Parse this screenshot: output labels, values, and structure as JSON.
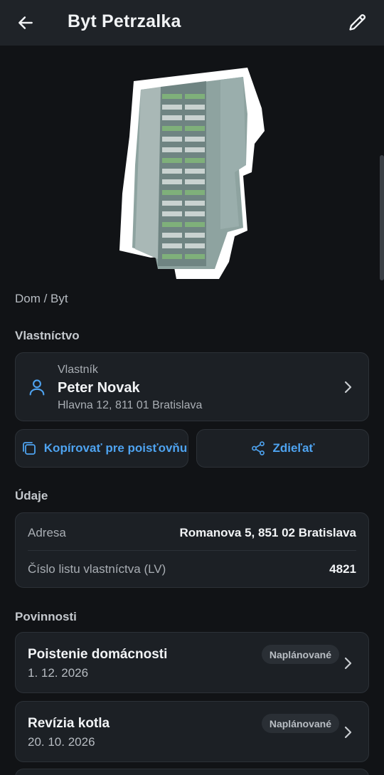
{
  "header": {
    "title": "Byt Petrzalka"
  },
  "property": {
    "category": "Dom / Byt"
  },
  "ownership": {
    "section_title": "Vlastníctvo",
    "owner_label": "Vlastník",
    "owner_name": "Peter Novak",
    "owner_address": "Hlavna 12, 811 01 Bratislava"
  },
  "actions": {
    "copy_label": "Kopírovať pre poisťovňu",
    "share_label": "Zdieľať"
  },
  "details": {
    "section_title": "Údaje",
    "rows": [
      {
        "label": "Adresa",
        "value": "Romanova 5, 851 02 Bratislava"
      },
      {
        "label": "Číslo listu vlastníctva (LV)",
        "value": "4821"
      }
    ]
  },
  "duties": {
    "section_title": "Povinnosti",
    "items": [
      {
        "title": "Poistenie domácnosti",
        "date": "1. 12. 2026",
        "status": "Naplánované"
      },
      {
        "title": "Revízia kotla",
        "date": "20. 10. 2026",
        "status": "Naplánované"
      }
    ]
  },
  "colors": {
    "accent": "#4ea3f0",
    "background": "#111316",
    "card": "#1c2025",
    "topbar": "#1f2328"
  }
}
